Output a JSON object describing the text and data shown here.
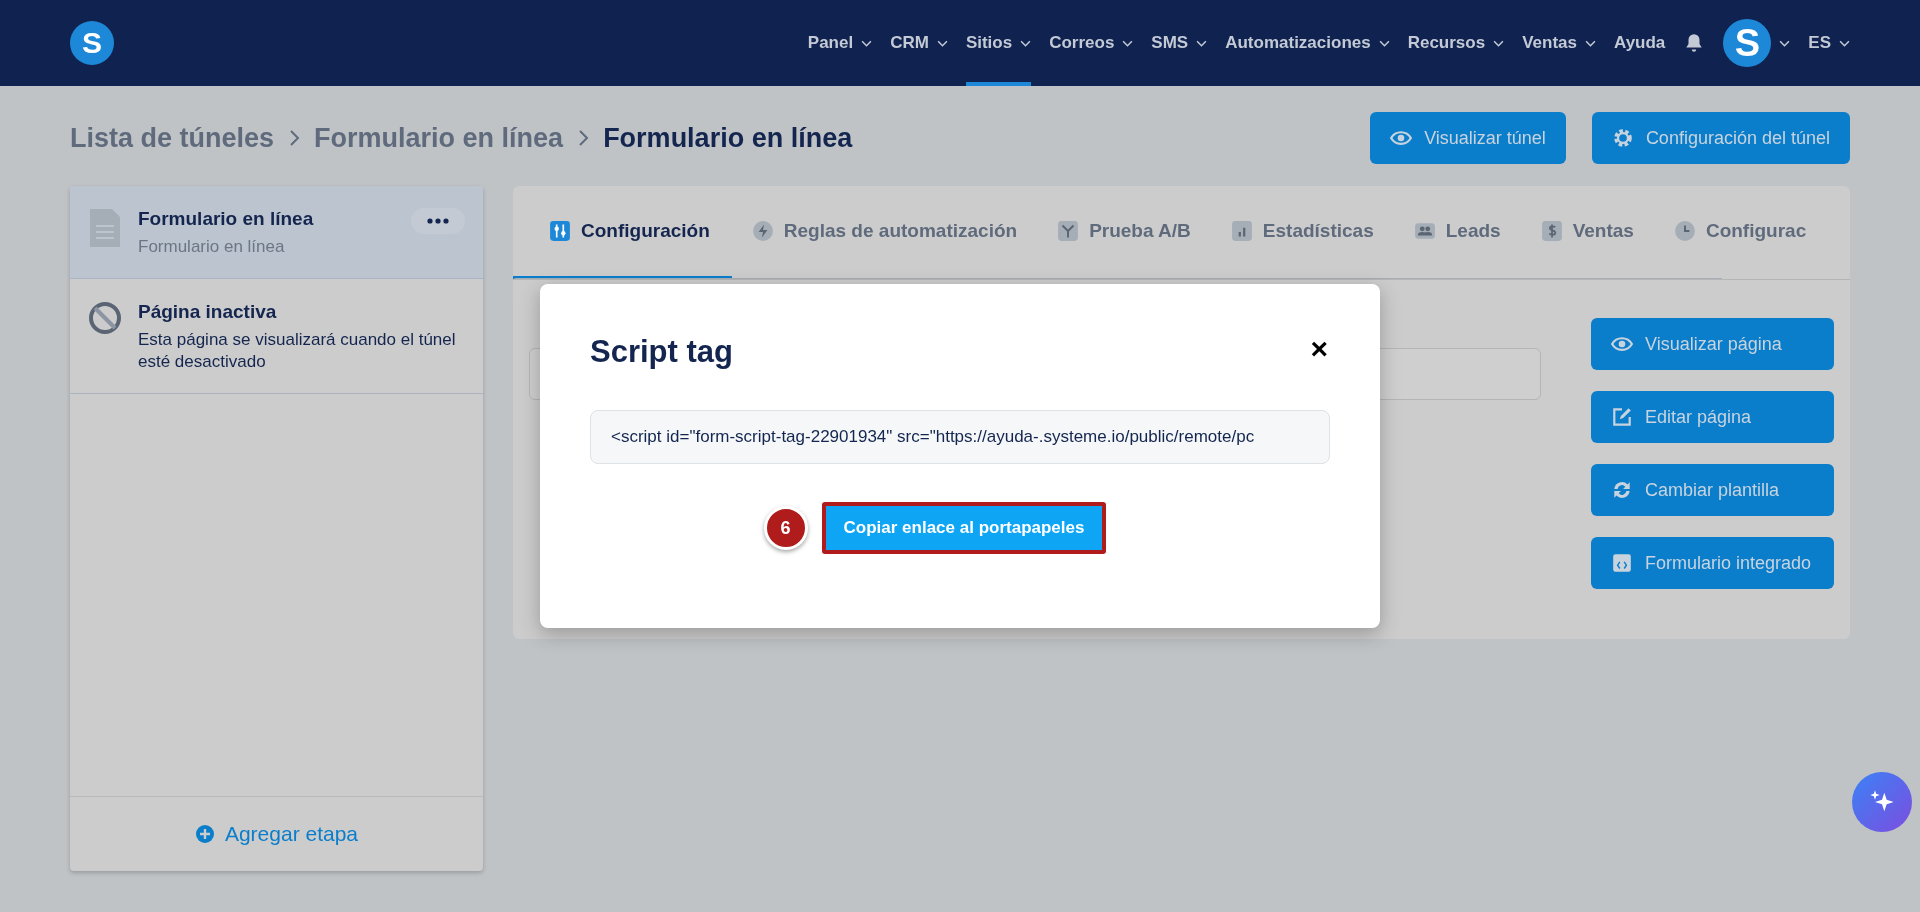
{
  "nav": {
    "logo": "S",
    "items": [
      {
        "label": "Panel",
        "selected": false,
        "dropdown": true
      },
      {
        "label": "CRM",
        "selected": false,
        "dropdown": true
      },
      {
        "label": "Sitios",
        "selected": true,
        "dropdown": true
      },
      {
        "label": "Correos",
        "selected": false,
        "dropdown": true
      },
      {
        "label": "SMS",
        "selected": false,
        "dropdown": true
      },
      {
        "label": "Automatizaciones",
        "selected": false,
        "dropdown": true
      },
      {
        "label": "Recursos",
        "selected": false,
        "dropdown": true
      },
      {
        "label": "Ventas",
        "selected": false,
        "dropdown": true
      },
      {
        "label": "Ayuda",
        "selected": false,
        "dropdown": false
      }
    ],
    "avatar": "S",
    "language": "ES"
  },
  "breadcrumb": [
    "Lista de túneles",
    "Formulario en línea",
    "Formulario en línea"
  ],
  "header_buttons": [
    {
      "label": "Visualizar túnel"
    },
    {
      "label": "Configuración del túnel"
    }
  ],
  "sidebar": {
    "steps": [
      {
        "kind": "page",
        "title": "Formulario en línea",
        "subtitle": "Formulario en línea",
        "selected": true
      },
      {
        "kind": "inactive",
        "title": "Página inactiva",
        "subtitle": "Esta página se visualizará cuando el túnel esté desactivado",
        "selected": false
      }
    ],
    "add_step": "Agregar etapa"
  },
  "tabs": [
    {
      "label": "Configuración",
      "selected": true
    },
    {
      "label": "Reglas de automatización",
      "selected": false
    },
    {
      "label": "Prueba A/B",
      "selected": false
    },
    {
      "label": "Estadísticas",
      "selected": false
    },
    {
      "label": "Leads",
      "selected": false
    },
    {
      "label": "Ventas",
      "selected": false
    },
    {
      "label": "Configurac",
      "selected": false
    }
  ],
  "page_buttons": [
    "Visualizar página",
    "Editar página",
    "Cambiar plantilla",
    "Formulario integrado"
  ],
  "modal": {
    "title": "Script tag",
    "close": "×",
    "code": "<script id=\"form-script-tag-22901934\" src=\"https://ayuda-.systeme.io/public/remote/pc",
    "button": "Copiar enlace al portapapeles",
    "step_badge": "6"
  }
}
